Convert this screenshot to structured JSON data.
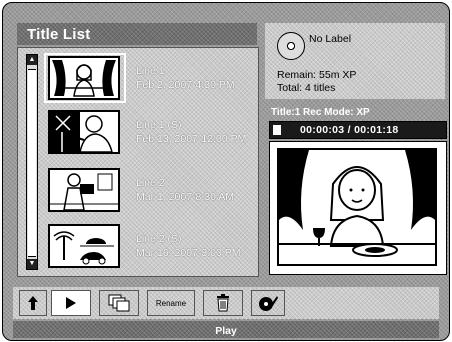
{
  "header": {
    "title": "Title List"
  },
  "titles": [
    {
      "name": "Line 1",
      "date": "Feb 2, 2007-4:30 PM"
    },
    {
      "name": "Line 1 (S)",
      "date": "Feb 13, 2007-12:00 PM"
    },
    {
      "name": "Line 2",
      "date": "Mar 1, 2007-8:30 AM"
    },
    {
      "name": "Line 2 (S)",
      "date": "Mar 16, 2007-3:00 PM"
    }
  ],
  "disc": {
    "label": "No Label",
    "remain": "Remain: 55m  XP",
    "total": "Total: 4 titles"
  },
  "playback": {
    "title_rec": "Title:1  Rec Mode: XP",
    "time": "00:00:03  /  00:01:18"
  },
  "toolbar": {
    "rename_label": "Rename"
  },
  "status": {
    "text": "Play"
  },
  "icons": {
    "up": "up-arrow-icon",
    "play": "play-icon",
    "copy": "copy-icon",
    "delete": "trash-icon",
    "edit": "disc-edit-icon"
  }
}
